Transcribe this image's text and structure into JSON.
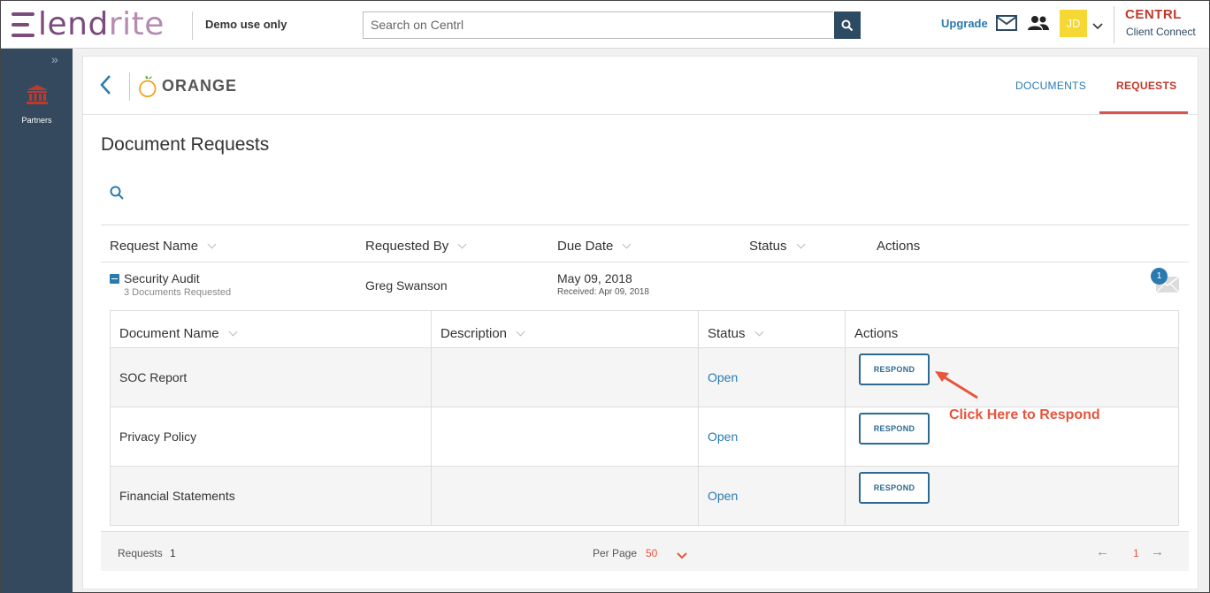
{
  "topbar": {
    "logo": "lendrite",
    "demo_label": "Demo use only",
    "search_placeholder": "Search on Centrl",
    "upgrade_label": "Upgrade",
    "avatar_initials": "JD",
    "brand_title": "CENTRL",
    "brand_subtitle": "Client Connect"
  },
  "sidebar": {
    "items": [
      {
        "label": "Partners",
        "icon": "bank-icon"
      }
    ]
  },
  "header": {
    "partner_logo_text": "ORANGE",
    "tabs": [
      {
        "label": "DOCUMENTS",
        "active": false
      },
      {
        "label": "REQUESTS",
        "active": true
      }
    ]
  },
  "page": {
    "title": "Document Requests"
  },
  "requests_table": {
    "columns": [
      "Request Name",
      "Requested By",
      "Due Date",
      "Status",
      "Actions"
    ],
    "rows": [
      {
        "name": "Security Audit",
        "sub": "3 Documents Requested",
        "requested_by": "Greg Swanson",
        "due_date": "May 09, 2018",
        "received": "Received: Apr 09, 2018",
        "message_count": "1"
      }
    ]
  },
  "documents_table": {
    "columns": [
      "Document Name",
      "Description",
      "Status",
      "Actions"
    ],
    "rows": [
      {
        "name": "SOC Report",
        "description": "",
        "status": "Open",
        "action": "RESPOND"
      },
      {
        "name": "Privacy Policy",
        "description": "",
        "status": "Open",
        "action": "RESPOND"
      },
      {
        "name": "Financial Statements",
        "description": "",
        "status": "Open",
        "action": "RESPOND"
      }
    ]
  },
  "annotation": {
    "text": "Click Here to Respond",
    "color": "#e8543c"
  },
  "footer": {
    "requests_label": "Requests",
    "requests_count": "1",
    "per_page_label": "Per Page",
    "per_page_value": "50",
    "prev_arrow": "←",
    "current_page": "1",
    "next_arrow": "→"
  },
  "colors": {
    "sidebar": "#34495e",
    "accent_blue": "#2a7ab0",
    "accent_red": "#c0392b",
    "brand_purple": "#7b4b7d"
  }
}
